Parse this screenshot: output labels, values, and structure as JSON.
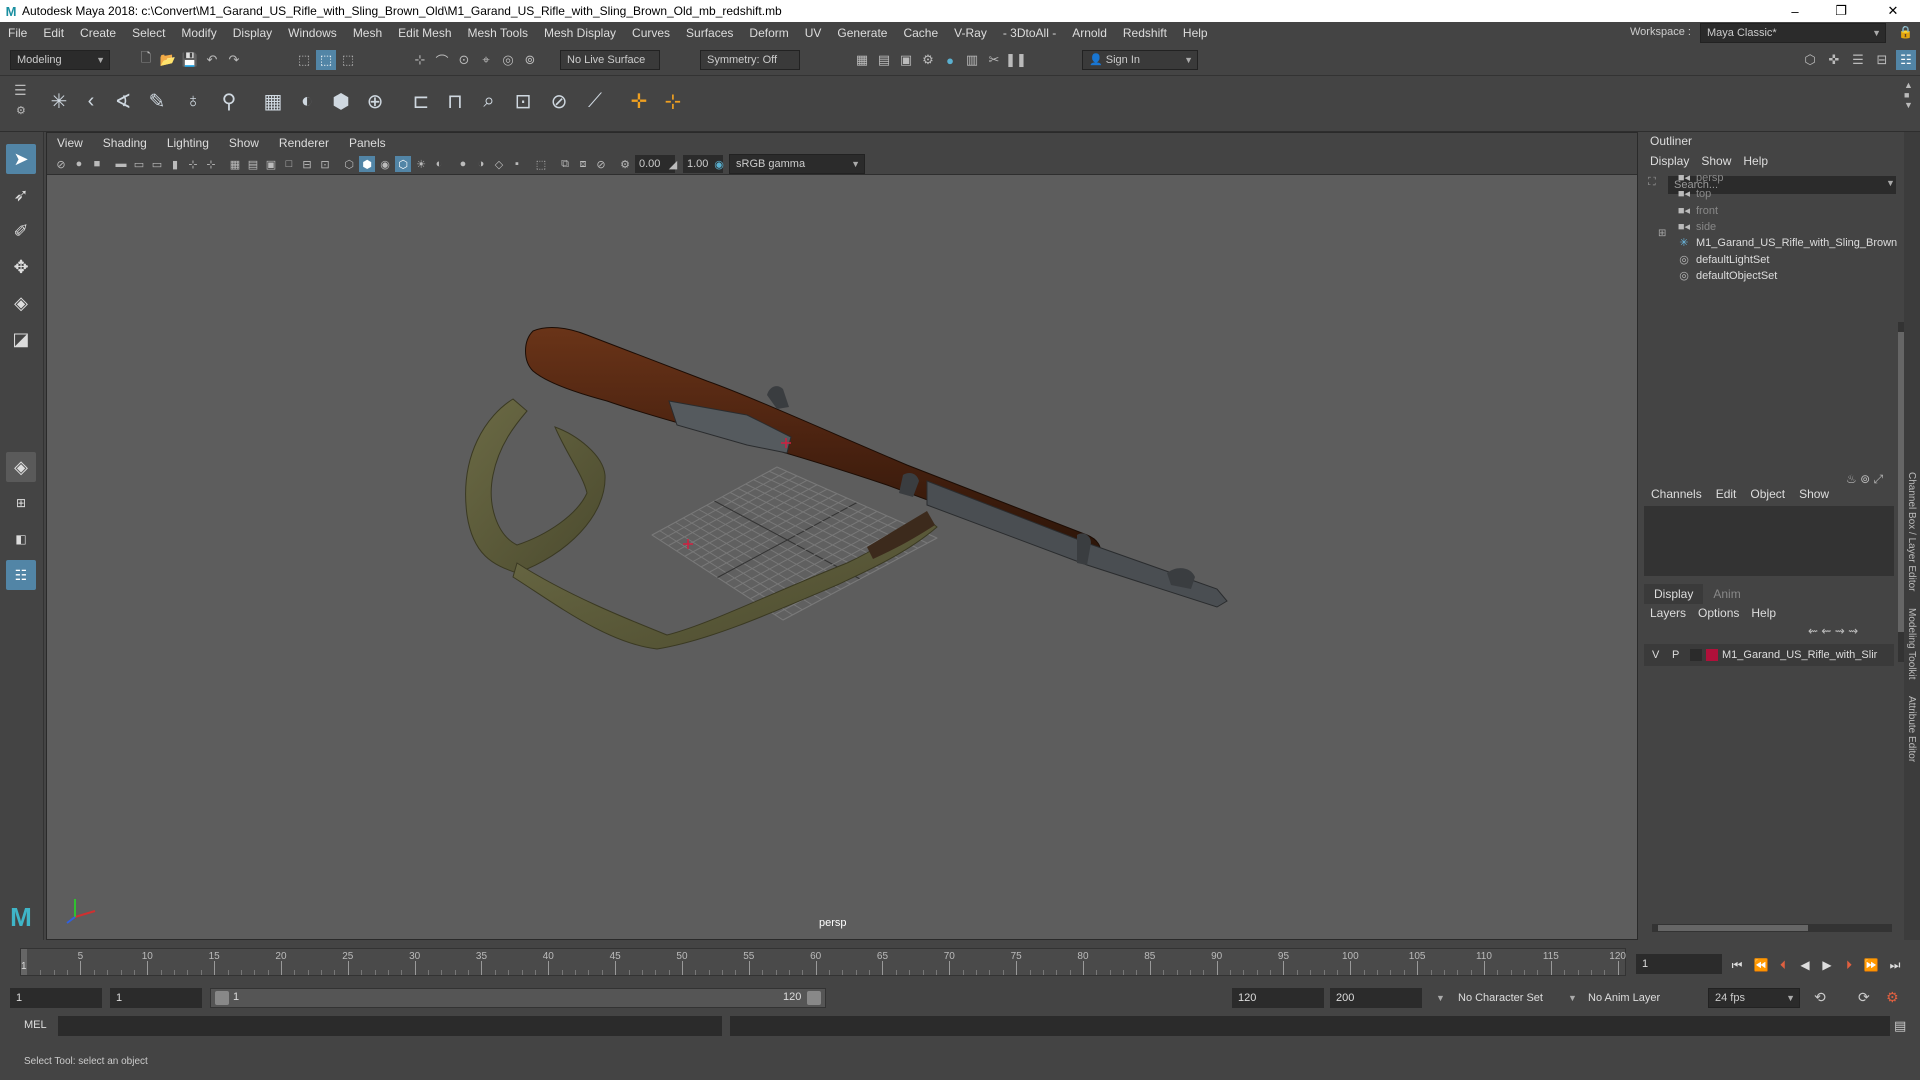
{
  "window": {
    "title": "Autodesk Maya 2018: c:\\Convert\\M1_Garand_US_Rifle_with_Sling_Brown_Old\\M1_Garand_US_Rifle_with_Sling_Brown_Old_mb_redshift.mb",
    "minimize": "–",
    "maximize": "❐",
    "close": "✕"
  },
  "menubar": {
    "items": [
      "File",
      "Edit",
      "Create",
      "Select",
      "Modify",
      "Display",
      "Windows",
      "Mesh",
      "Edit Mesh",
      "Mesh Tools",
      "Mesh Display",
      "Curves",
      "Surfaces",
      "Deform",
      "UV",
      "Generate",
      "Cache",
      "V-Ray",
      "- 3DtoAll -",
      "Arnold",
      "Redshift",
      "Help"
    ],
    "workspace_label": "Workspace :",
    "workspace_value": "Maya Classic*"
  },
  "statusline": {
    "mode": "Modeling",
    "live_surface": "No Live Surface",
    "symmetry": "Symmetry: Off",
    "sign_in": "Sign In"
  },
  "viewport": {
    "menu": [
      "View",
      "Shading",
      "Lighting",
      "Show",
      "Renderer",
      "Panels"
    ],
    "exposure": "0.00",
    "gamma": "1.00",
    "color_space": "sRGB gamma",
    "camera": "persp"
  },
  "outliner": {
    "title": "Outliner",
    "menu": [
      "Display",
      "Show",
      "Help"
    ],
    "search_placeholder": "Search...",
    "items": [
      {
        "label": "persp",
        "icon": "camera-icon",
        "dim": true
      },
      {
        "label": "top",
        "icon": "camera-icon",
        "dim": true
      },
      {
        "label": "front",
        "icon": "camera-icon",
        "dim": true
      },
      {
        "label": "side",
        "icon": "camera-icon",
        "dim": true
      },
      {
        "label": "M1_Garand_US_Rifle_with_Sling_Brown",
        "icon": "group-icon",
        "dim": false
      },
      {
        "label": "defaultLightSet",
        "icon": "set-icon",
        "dim": false
      },
      {
        "label": "defaultObjectSet",
        "icon": "set-icon",
        "dim": false
      }
    ]
  },
  "channelbox": {
    "menu": [
      "Channels",
      "Edit",
      "Object",
      "Show"
    ]
  },
  "layer_editor": {
    "tabs": [
      "Display",
      "Anim"
    ],
    "menu": [
      "Layers",
      "Options",
      "Help"
    ],
    "layer": {
      "v": "V",
      "p": "P",
      "name": "M1_Garand_US_Rifle_with_Slir",
      "color": "#b0103a"
    }
  },
  "side_tabs": [
    "Channel Box / Layer Editor",
    "Modeling Toolkit",
    "Attribute Editor"
  ],
  "timeline": {
    "ticks": [
      "5",
      "10",
      "15",
      "20",
      "25",
      "30",
      "35",
      "40",
      "45",
      "50",
      "55",
      "60",
      "65",
      "70",
      "75",
      "80",
      "85",
      "90",
      "95",
      "100",
      "105",
      "110",
      "115",
      "120"
    ],
    "current_marker": "1",
    "current_frame": "1"
  },
  "range": {
    "start": "1",
    "playback_start": "1",
    "slider_start": "1",
    "slider_end": "120",
    "playback_end": "120",
    "end": "200",
    "character_set": "No Character Set",
    "anim_layer": "No Anim Layer",
    "fps": "24 fps"
  },
  "cmdline": {
    "label": "MEL"
  },
  "helpline": {
    "text": "Select Tool: select an object"
  },
  "colors": {
    "accent": "#5285a6",
    "viewport_bg": "#5d5d5d",
    "panel_bg": "#444444"
  }
}
